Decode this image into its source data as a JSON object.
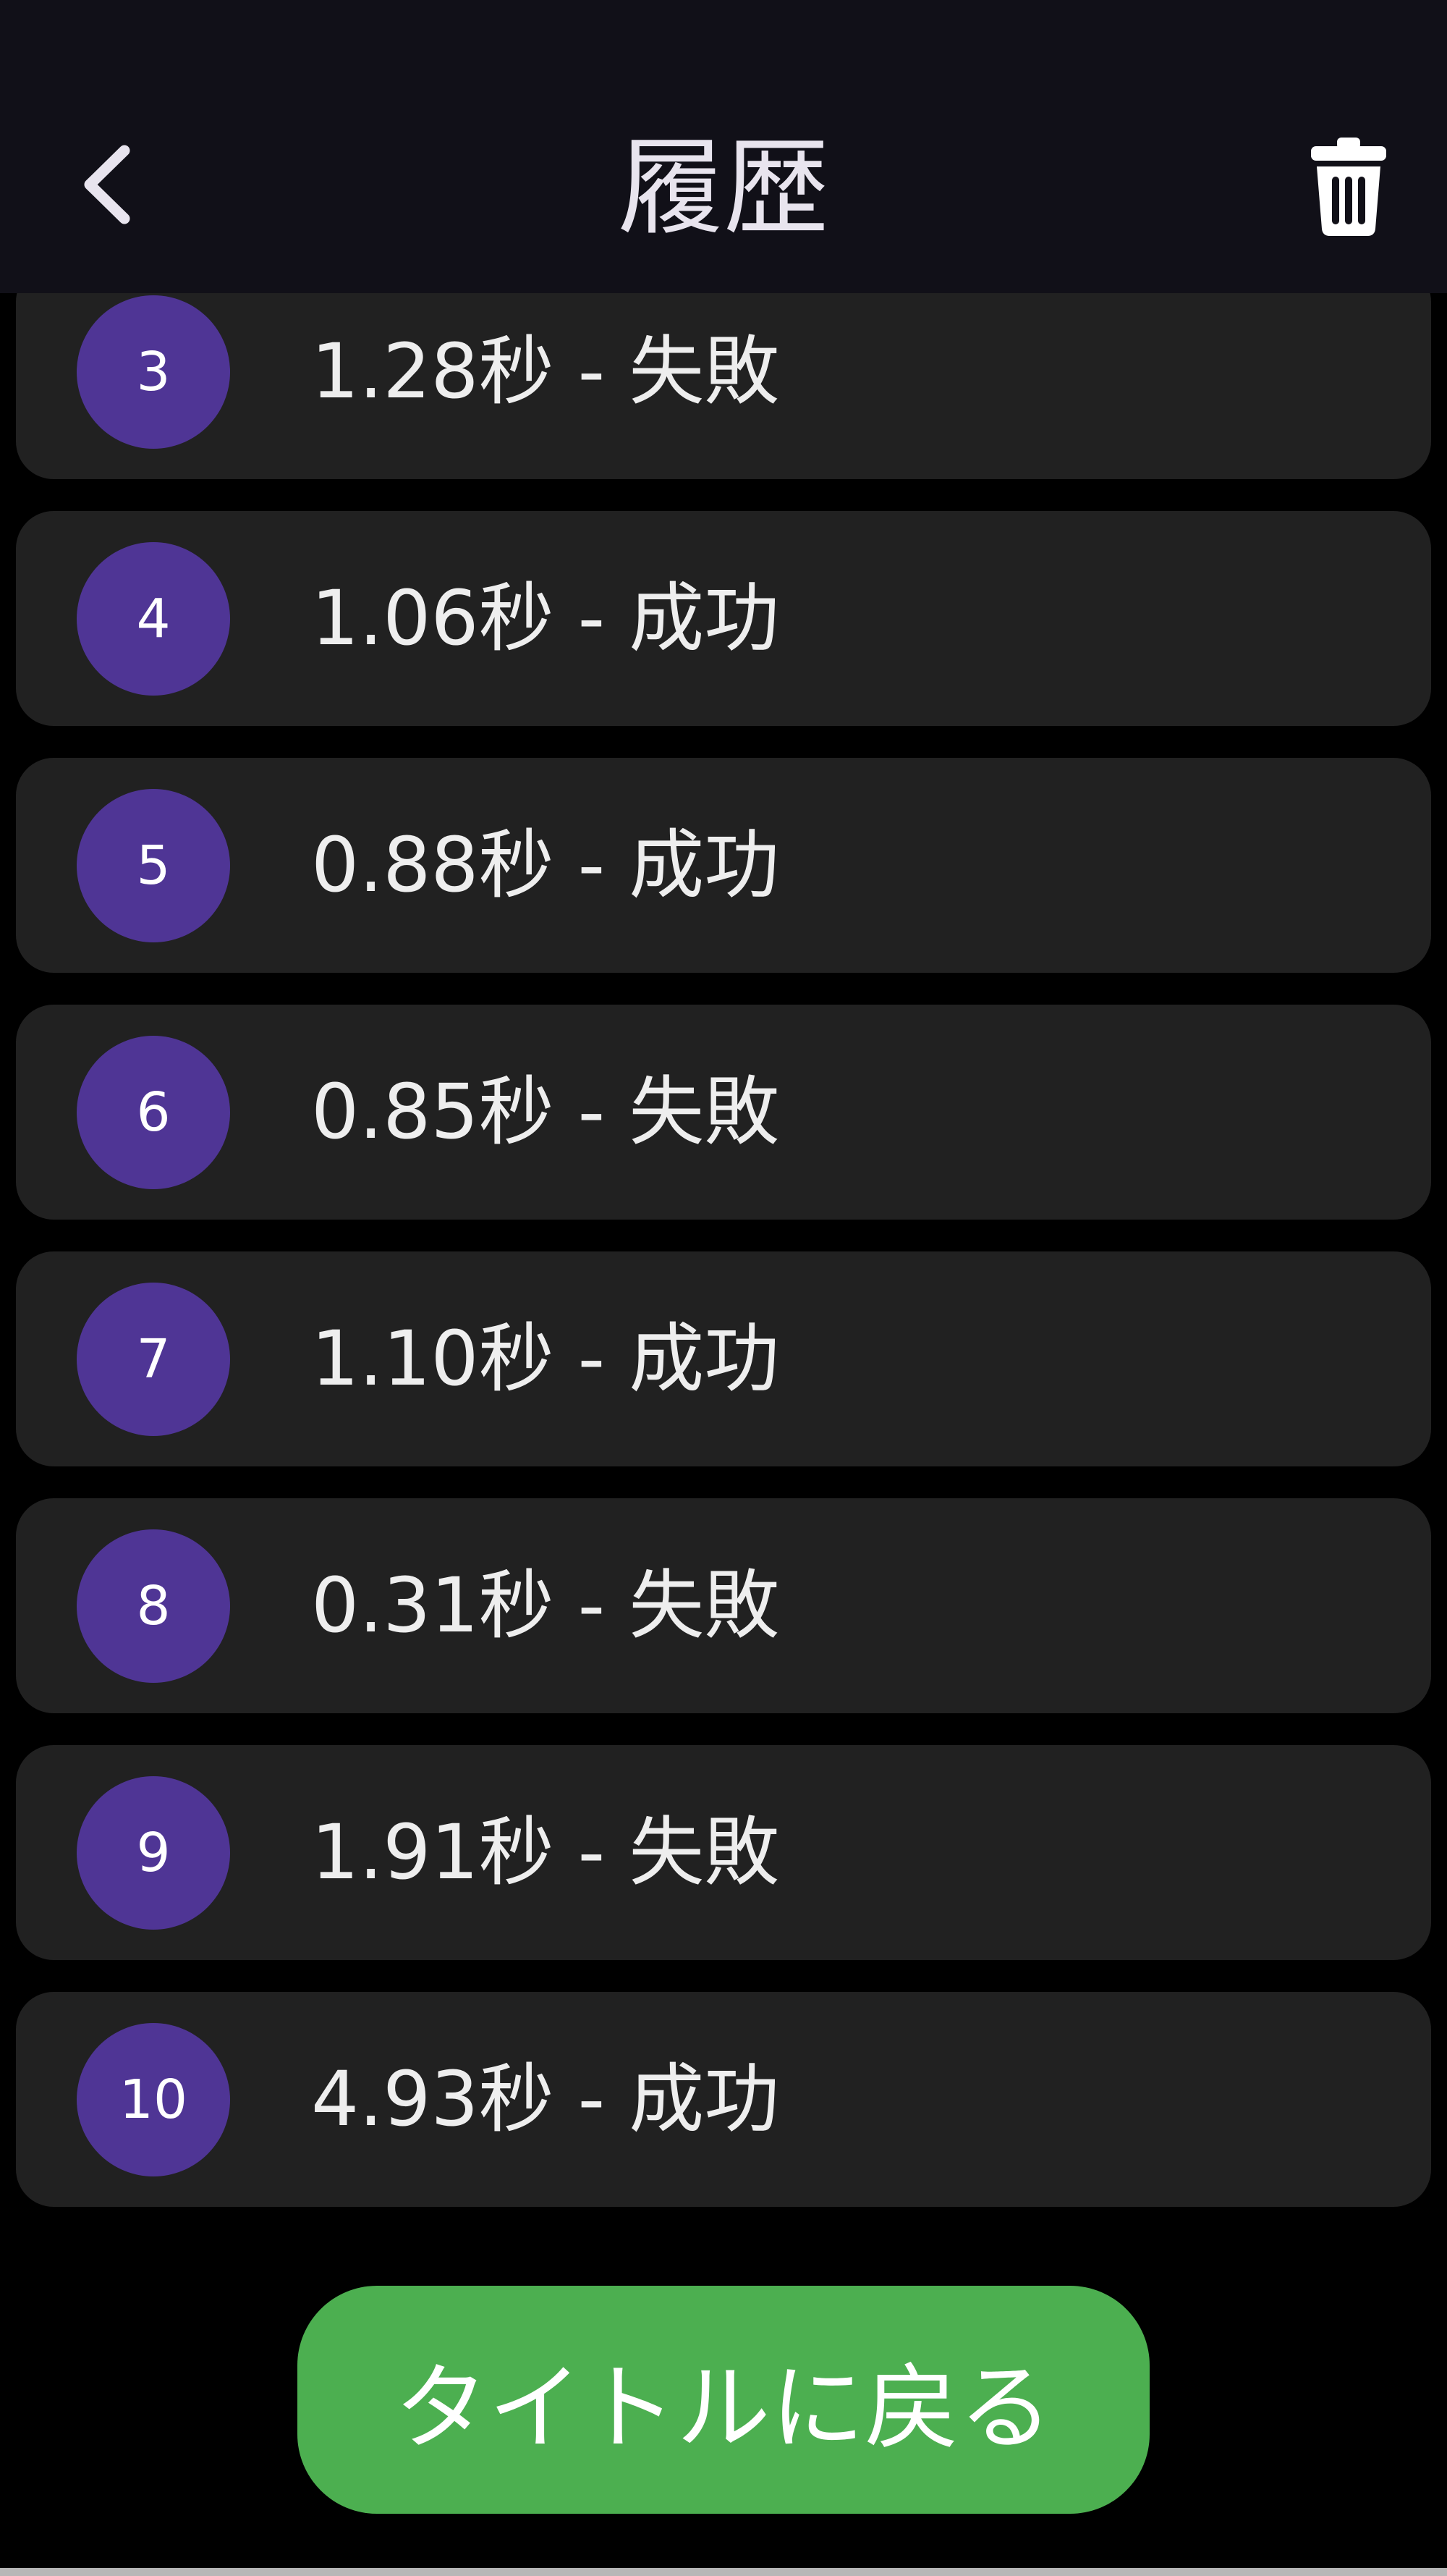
{
  "header": {
    "title": "履歴",
    "back_icon": "chevron-left-icon",
    "trash_icon": "trash-icon",
    "background": "#111018"
  },
  "history": {
    "items": [
      {
        "number": "3",
        "label": "1.28秒 - 失敗"
      },
      {
        "number": "4",
        "label": "1.06秒 - 成功"
      },
      {
        "number": "5",
        "label": "0.88秒 - 成功"
      },
      {
        "number": "6",
        "label": "0.85秒 - 失敗"
      },
      {
        "number": "7",
        "label": "1.10秒 - 成功"
      },
      {
        "number": "8",
        "label": "0.31秒 - 失敗"
      },
      {
        "number": "9",
        "label": "1.91秒 - 失敗"
      },
      {
        "number": "10",
        "label": "4.93秒 - 成功"
      }
    ],
    "badge_color": "#4f3595",
    "row_color": "#212121"
  },
  "footer": {
    "return_label": "タイトルに戻る",
    "button_color": "#4caf50"
  }
}
